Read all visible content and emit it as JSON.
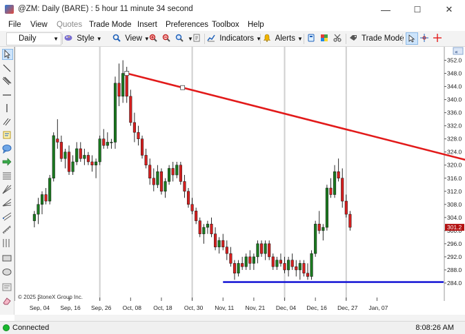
{
  "window": {
    "title": "@ZM: Daily (BARE) : 5 hour 11 minute 34 second",
    "minimize": "—",
    "maximize": "☐",
    "close": "✕"
  },
  "menu": {
    "file": "File",
    "view": "View",
    "quotes": "Quotes",
    "trade_mode": "Trade Mode",
    "insert": "Insert",
    "preferences": "Preferences",
    "toolbox": "Toolbox",
    "help": "Help"
  },
  "toolbar": {
    "interval": "Daily",
    "style": "Style",
    "view": "View",
    "indicators": "Indicators",
    "alerts": "Alerts",
    "trade_mode": "Trade Mode"
  },
  "status": {
    "connection": "Connected",
    "time": "8:08:26 AM"
  },
  "colors": {
    "up": "#1a7a1f",
    "down": "#d71f1f",
    "trendline": "#e21a1a",
    "support": "#1a1ad6",
    "price_tag": "#b31010",
    "connected": "#19b82f"
  },
  "chart_data": {
    "type": "candlestick",
    "symbol": "@ZM",
    "interval": "Daily",
    "copyright": "© 2025 StoneX Group Inc.",
    "last_price_label": "301.2",
    "ylim": [
      280,
      354
    ],
    "y_ticks": [
      352.0,
      348.0,
      344.0,
      340.0,
      336.0,
      332.0,
      328.0,
      324.0,
      320.0,
      316.0,
      312.0,
      308.0,
      304.0,
      300.0,
      296.0,
      292.0,
      288.0,
      284.0
    ],
    "x_tick_labels": [
      "Sep, 04",
      "Sep, 16",
      "Sep, 26",
      "Oct, 08",
      "Oct, 18",
      "Oct, 30",
      "Nov, 11",
      "Nov, 21",
      "Dec, 04",
      "Dec, 16",
      "Dec, 27",
      "Jan, 07"
    ],
    "x_tick_bar_index": [
      5,
      13,
      21,
      29,
      37,
      45,
      53,
      61,
      69,
      77,
      85,
      93
    ],
    "vertical_grid_bar_index": [
      21,
      45,
      69,
      85
    ],
    "candles": [
      {
        "o": 303,
        "h": 306,
        "l": 301,
        "c": 305
      },
      {
        "o": 305,
        "h": 310,
        "l": 302,
        "c": 308
      },
      {
        "o": 308,
        "h": 312,
        "l": 305,
        "c": 311
      },
      {
        "o": 311,
        "h": 313,
        "l": 308,
        "c": 309
      },
      {
        "o": 309,
        "h": 317,
        "l": 308,
        "c": 316
      },
      {
        "o": 316,
        "h": 330,
        "l": 315,
        "c": 329
      },
      {
        "o": 328,
        "h": 334,
        "l": 325,
        "c": 327
      },
      {
        "o": 327,
        "h": 329,
        "l": 321,
        "c": 322
      },
      {
        "o": 322,
        "h": 325,
        "l": 319,
        "c": 324
      },
      {
        "o": 324,
        "h": 326,
        "l": 317,
        "c": 318
      },
      {
        "o": 318,
        "h": 323,
        "l": 317,
        "c": 321
      },
      {
        "o": 321,
        "h": 327,
        "l": 320,
        "c": 325
      },
      {
        "o": 325,
        "h": 327,
        "l": 321,
        "c": 322
      },
      {
        "o": 322,
        "h": 325,
        "l": 320,
        "c": 323
      },
      {
        "o": 323,
        "h": 324,
        "l": 320,
        "c": 321
      },
      {
        "o": 321,
        "h": 323,
        "l": 318,
        "c": 320
      },
      {
        "o": 320,
        "h": 322,
        "l": 316,
        "c": 321
      },
      {
        "o": 321,
        "h": 329,
        "l": 320,
        "c": 328
      },
      {
        "o": 328,
        "h": 331,
        "l": 325,
        "c": 326
      },
      {
        "o": 326,
        "h": 330,
        "l": 325,
        "c": 327
      },
      {
        "o": 327,
        "h": 328,
        "l": 325,
        "c": 327
      },
      {
        "o": 327,
        "h": 347,
        "l": 325,
        "c": 345
      },
      {
        "o": 345,
        "h": 351,
        "l": 338,
        "c": 341
      },
      {
        "o": 341,
        "h": 352,
        "l": 339,
        "c": 348
      },
      {
        "o": 348,
        "h": 350,
        "l": 339,
        "c": 341
      },
      {
        "o": 341,
        "h": 343,
        "l": 332,
        "c": 333
      },
      {
        "o": 333,
        "h": 336,
        "l": 327,
        "c": 330
      },
      {
        "o": 330,
        "h": 332,
        "l": 326,
        "c": 328
      },
      {
        "o": 328,
        "h": 329,
        "l": 322,
        "c": 323
      },
      {
        "o": 323,
        "h": 325,
        "l": 319,
        "c": 320
      },
      {
        "o": 320,
        "h": 322,
        "l": 314,
        "c": 316
      },
      {
        "o": 316,
        "h": 319,
        "l": 312,
        "c": 314
      },
      {
        "o": 314,
        "h": 320,
        "l": 313,
        "c": 318
      },
      {
        "o": 318,
        "h": 319,
        "l": 311,
        "c": 312
      },
      {
        "o": 312,
        "h": 316,
        "l": 310,
        "c": 315
      },
      {
        "o": 315,
        "h": 320,
        "l": 314,
        "c": 319
      },
      {
        "o": 319,
        "h": 321,
        "l": 315,
        "c": 317
      },
      {
        "o": 317,
        "h": 321,
        "l": 316,
        "c": 320
      },
      {
        "o": 320,
        "h": 321,
        "l": 314,
        "c": 315
      },
      {
        "o": 315,
        "h": 317,
        "l": 310,
        "c": 312
      },
      {
        "o": 312,
        "h": 313,
        "l": 307,
        "c": 308
      },
      {
        "o": 308,
        "h": 310,
        "l": 305,
        "c": 306
      },
      {
        "o": 306,
        "h": 307,
        "l": 302,
        "c": 303
      },
      {
        "o": 303,
        "h": 304,
        "l": 298,
        "c": 299
      },
      {
        "o": 299,
        "h": 302,
        "l": 296,
        "c": 301
      },
      {
        "o": 301,
        "h": 303,
        "l": 299,
        "c": 302
      },
      {
        "o": 302,
        "h": 304,
        "l": 298,
        "c": 299
      },
      {
        "o": 299,
        "h": 301,
        "l": 294,
        "c": 295
      },
      {
        "o": 295,
        "h": 298,
        "l": 293,
        "c": 297
      },
      {
        "o": 297,
        "h": 299,
        "l": 294,
        "c": 295
      },
      {
        "o": 295,
        "h": 297,
        "l": 291,
        "c": 293
      },
      {
        "o": 293,
        "h": 295,
        "l": 289,
        "c": 290
      },
      {
        "o": 290,
        "h": 291,
        "l": 285,
        "c": 287
      },
      {
        "o": 287,
        "h": 291,
        "l": 286,
        "c": 290
      },
      {
        "o": 290,
        "h": 292,
        "l": 288,
        "c": 289
      },
      {
        "o": 289,
        "h": 293,
        "l": 288,
        "c": 292
      },
      {
        "o": 292,
        "h": 294,
        "l": 288,
        "c": 290
      },
      {
        "o": 290,
        "h": 293,
        "l": 288,
        "c": 292
      },
      {
        "o": 292,
        "h": 297,
        "l": 290,
        "c": 296
      },
      {
        "o": 296,
        "h": 297,
        "l": 292,
        "c": 293
      },
      {
        "o": 293,
        "h": 297,
        "l": 291,
        "c": 296
      },
      {
        "o": 296,
        "h": 297,
        "l": 291,
        "c": 292
      },
      {
        "o": 292,
        "h": 293,
        "l": 288,
        "c": 289
      },
      {
        "o": 289,
        "h": 292,
        "l": 288,
        "c": 291
      },
      {
        "o": 291,
        "h": 293,
        "l": 289,
        "c": 290
      },
      {
        "o": 290,
        "h": 292,
        "l": 287,
        "c": 288
      },
      {
        "o": 288,
        "h": 292,
        "l": 286,
        "c": 291
      },
      {
        "o": 291,
        "h": 293,
        "l": 288,
        "c": 289
      },
      {
        "o": 289,
        "h": 291,
        "l": 286,
        "c": 288
      },
      {
        "o": 288,
        "h": 291,
        "l": 285,
        "c": 290
      },
      {
        "o": 290,
        "h": 291,
        "l": 286,
        "c": 287
      },
      {
        "o": 287,
        "h": 290,
        "l": 285,
        "c": 286
      },
      {
        "o": 286,
        "h": 294,
        "l": 285,
        "c": 293
      },
      {
        "o": 293,
        "h": 303,
        "l": 292,
        "c": 302
      },
      {
        "o": 302,
        "h": 306,
        "l": 299,
        "c": 300
      },
      {
        "o": 300,
        "h": 302,
        "l": 297,
        "c": 301
      },
      {
        "o": 301,
        "h": 314,
        "l": 300,
        "c": 313
      },
      {
        "o": 313,
        "h": 316,
        "l": 310,
        "c": 311
      },
      {
        "o": 311,
        "h": 320,
        "l": 310,
        "c": 318
      },
      {
        "o": 318,
        "h": 322,
        "l": 315,
        "c": 316
      },
      {
        "o": 316,
        "h": 319,
        "l": 307,
        "c": 309
      },
      {
        "o": 309,
        "h": 311,
        "l": 304,
        "c": 305
      },
      {
        "o": 305,
        "h": 306,
        "l": 300,
        "c": 301
      }
    ],
    "candle_x_offset": 4,
    "drawings": [
      {
        "type": "trendline",
        "from_bar": 24,
        "from_price": 348.0,
        "to_bar": 999,
        "to_price": null,
        "slope_per_bar": -0.3
      },
      {
        "type": "horizontal",
        "price": 284.3,
        "from_bar": 49
      }
    ]
  }
}
